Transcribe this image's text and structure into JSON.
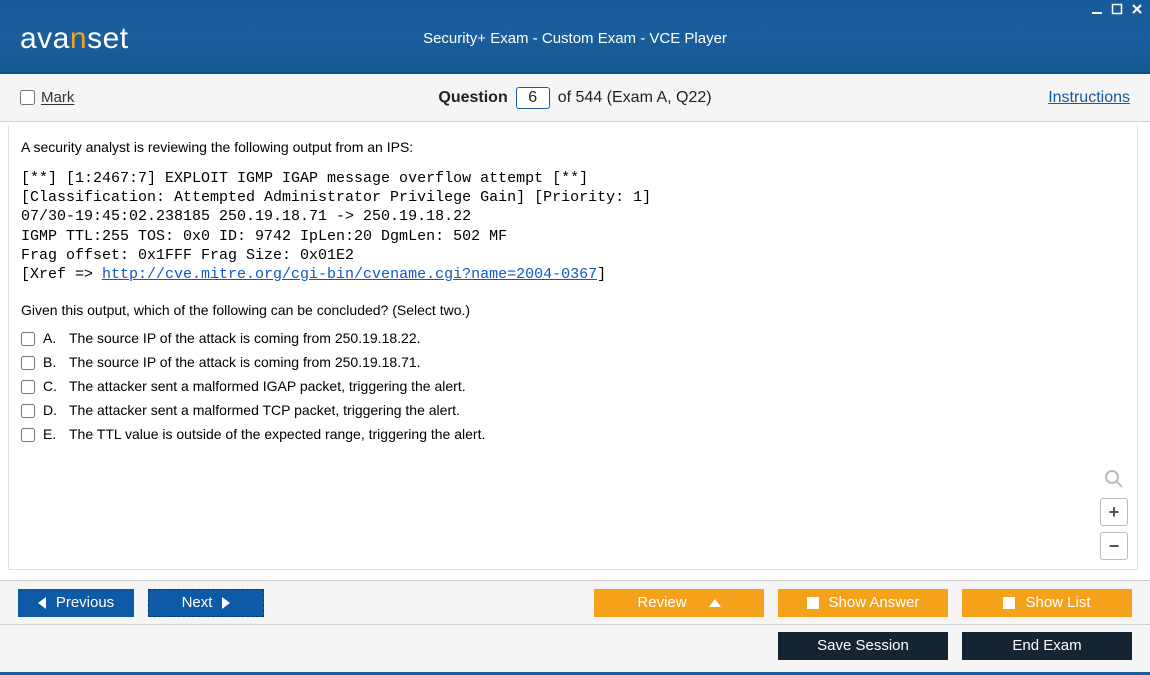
{
  "window": {
    "app_logo_prefix": "ava",
    "app_logo_accent": "n",
    "app_logo_suffix": "set",
    "title": "Security+ Exam - Custom Exam - VCE Player"
  },
  "header": {
    "mark_label": "Mark",
    "question_label": "Question",
    "question_number": "6",
    "question_total_suffix": "of 544 (Exam A, Q22)",
    "instructions_label": "Instructions"
  },
  "question": {
    "stem": "A security analyst is reviewing the following output from an IPS:",
    "ips_line1": "[**] [1:2467:7] EXPLOIT IGMP IGAP message overflow attempt [**]",
    "ips_line2": "[Classification: Attempted Administrator Privilege Gain] [Priority: 1]",
    "ips_line3": "07/30-19:45:02.238185 250.19.18.71 -> 250.19.18.22",
    "ips_line4": "IGMP TTL:255 TOS: 0x0 ID: 9742 IpLen:20 DgmLen: 502 MF",
    "ips_line5": "Frag offset: 0x1FFF Frag Size: 0x01E2",
    "ips_xref_prefix": "[Xref => ",
    "ips_xref_link": "http://cve.mitre.org/cgi-bin/cvename.cgi?name=2004-0367",
    "ips_xref_suffix": "]",
    "prompt": "Given this output, which of the following can be concluded? (Select two.)",
    "options": [
      {
        "letter": "A.",
        "text": "The source IP of the attack is coming from 250.19.18.22."
      },
      {
        "letter": "B.",
        "text": "The source IP of the attack is coming from 250.19.18.71."
      },
      {
        "letter": "C.",
        "text": "The attacker sent a malformed IGAP packet, triggering the alert."
      },
      {
        "letter": "D.",
        "text": "The attacker sent a malformed TCP packet, triggering the alert."
      },
      {
        "letter": "E.",
        "text": "The TTL value is outside of the expected range, triggering the alert."
      }
    ]
  },
  "zoom": {
    "plus": "+",
    "minus": "−"
  },
  "buttons": {
    "previous": "Previous",
    "next": "Next",
    "review": "Review",
    "show_answer": "Show Answer",
    "show_list": "Show List",
    "save_session": "Save Session",
    "end_exam": "End Exam"
  }
}
